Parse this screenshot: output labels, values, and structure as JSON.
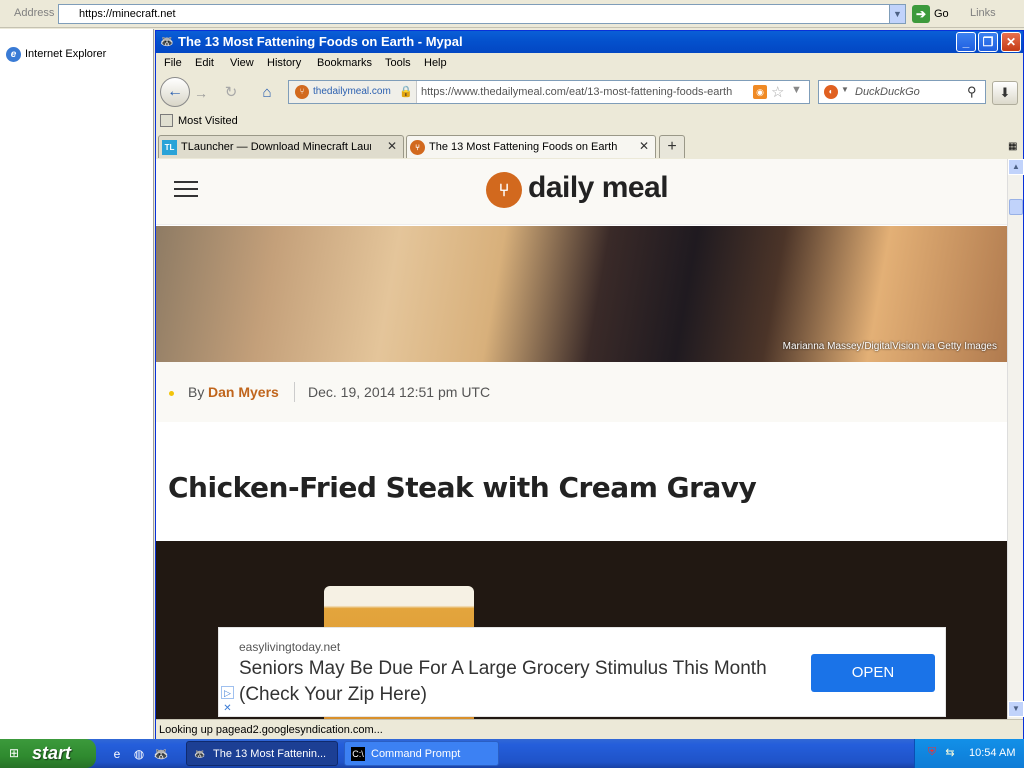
{
  "ie": {
    "address_label": "Address",
    "address_value": "https://minecraft.net",
    "go_label": "Go",
    "links_label": "Links",
    "side_item_label": "Internet Explorer"
  },
  "firefox": {
    "window_title": "The 13 Most Fattening Foods on Earth - Mypal",
    "menus": [
      "File",
      "Edit",
      "View",
      "History",
      "Bookmarks",
      "Tools",
      "Help"
    ],
    "url_site": "thedailymeal.com",
    "url": "https://www.thedailymeal.com/eat/13-most-fattening-foods-earth",
    "search_placeholder": "DuckDuckGo",
    "bookmark": "Most Visited",
    "tabs": [
      {
        "icon_text": "TL",
        "title": "TLauncher — Download Minecraft Launch..."
      },
      {
        "icon_text": "",
        "title": "The 13 Most Fattening Foods on Earth"
      }
    ],
    "new_tab_glyph": "+",
    "status_text": "Looking up pagead2.googlesyndication.com..."
  },
  "page": {
    "logo_text": "daily meal",
    "hero_credit": "Marianna Massey/DigitalVision via Getty Images",
    "byline_by": "By",
    "author": "Dan Myers",
    "date": "Dec. 19, 2014 12:51 pm UTC",
    "heading": "Chicken-Fried Steak with Cream Gravy"
  },
  "ad": {
    "source": "easylivingtoday.net",
    "text": "Seniors May Be Due For A Large Grocery Stimulus This Month (Check Your Zip Here)",
    "button": "OPEN"
  },
  "taskbar": {
    "start_label": "start",
    "tasks": [
      {
        "label": "The 13 Most Fattenin..."
      },
      {
        "label": "Command Prompt"
      }
    ],
    "clock": "10:54 AM"
  },
  "icons": {
    "back": "back-arrow-icon",
    "forward": "forward-arrow-icon",
    "reload": "reload-icon",
    "home": "home-icon",
    "lock": "lock-icon",
    "rss": "rss-icon",
    "star": "bookmark-star-icon",
    "search": "magnifier-icon",
    "download": "download-icon"
  },
  "colors": {
    "xp_blue": "#0a5fd7",
    "start_green": "#3c9a3c",
    "brand_orange": "#d2691e",
    "ad_button": "#1a73e8"
  }
}
